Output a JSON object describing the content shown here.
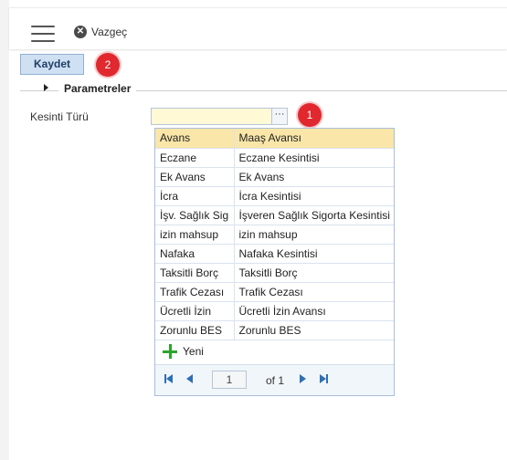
{
  "toolbar": {
    "cancel_label": "Vazgeç",
    "save_label": "Kaydet"
  },
  "badges": {
    "save_step": "2",
    "field_step": "1"
  },
  "section": {
    "title": "Parametreler"
  },
  "field": {
    "label": "Kesinti Türü",
    "value": "",
    "button": "···"
  },
  "dropdown": {
    "rows": [
      {
        "code": "Avans",
        "name": "Maaş Avansı",
        "selected": true
      },
      {
        "code": "Eczane",
        "name": "Eczane Kesintisi"
      },
      {
        "code": "Ek Avans",
        "name": "Ek Avans"
      },
      {
        "code": "İcra",
        "name": "İcra Kesintisi"
      },
      {
        "code": "İşv. Sağlık Sig",
        "name": "İşveren Sağlık Sigorta Kesintisi"
      },
      {
        "code": "izin mahsup",
        "name": "izin mahsup"
      },
      {
        "code": "Nafaka",
        "name": "Nafaka Kesintisi"
      },
      {
        "code": "Taksitli Borç",
        "name": "Taksitli Borç"
      },
      {
        "code": "Trafik Cezası",
        "name": "Trafik Cezası"
      },
      {
        "code": "Ücretli İzin",
        "name": "Ücretli İzin Avansı"
      },
      {
        "code": "Zorunlu BES",
        "name": "Zorunlu BES"
      }
    ],
    "new_label": "Yeni"
  },
  "pager": {
    "page": "1",
    "of_label": "of 1"
  },
  "colors": {
    "accent": "#2f6fb3",
    "selected_row": "#f9e6a8",
    "badge": "#e0282e",
    "field_bg": "#fff9d6",
    "add": "#2aa52a"
  }
}
